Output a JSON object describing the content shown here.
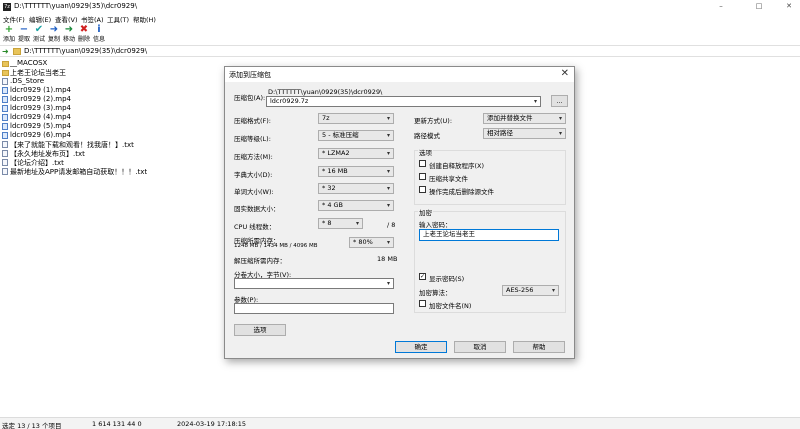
{
  "window": {
    "title": "D:\\TTTTTT\\yuan\\0929(35)\\dcr0929\\",
    "app_icon": "7z",
    "controls": [
      "–",
      "□",
      "✕"
    ]
  },
  "menu": [
    "文件(F)",
    "编辑(E)",
    "查看(V)",
    "书签(A)",
    "工具(T)",
    "帮助(H)"
  ],
  "toolbar": [
    {
      "label": "添加",
      "icon": "add-icon",
      "glyph": "+",
      "color": "#2a9d2a"
    },
    {
      "label": "提取",
      "icon": "extract-icon",
      "glyph": "−",
      "color": "#1f5fc4"
    },
    {
      "label": "测试",
      "icon": "test-icon",
      "glyph": "✔",
      "color": "#1aa3a3"
    },
    {
      "label": "复制",
      "icon": "copy-icon",
      "glyph": "➜",
      "color": "#1f5fc4"
    },
    {
      "label": "移动",
      "icon": "move-icon",
      "glyph": "➜",
      "color": "#1a8a3a"
    },
    {
      "label": "删除",
      "icon": "delete-icon",
      "glyph": "✖",
      "color": "#d02020"
    },
    {
      "label": "信息",
      "icon": "info-icon",
      "glyph": "i",
      "color": "#1f5fc4"
    }
  ],
  "address": {
    "path": "D:\\TTTTTT\\yuan\\0929(35)\\dcr0929\\"
  },
  "files": [
    {
      "name": "__MACOSX",
      "type": "folder"
    },
    {
      "name": "上老王论坛当老王",
      "type": "folder"
    },
    {
      "name": ".DS_Store",
      "type": "file"
    },
    {
      "name": "ldcr0929 (1).mp4",
      "type": "mp4"
    },
    {
      "name": "ldcr0929 (2).mp4",
      "type": "mp4"
    },
    {
      "name": "ldcr0929 (3).mp4",
      "type": "mp4"
    },
    {
      "name": "ldcr0929 (4).mp4",
      "type": "mp4"
    },
    {
      "name": "ldcr0929 (5).mp4",
      "type": "mp4"
    },
    {
      "name": "ldcr0929 (6).mp4",
      "type": "mp4"
    },
    {
      "name": "【来了就能下载和观看！找我唐！】.txt",
      "type": "file"
    },
    {
      "name": "【永久地址发布页】.txt",
      "type": "file"
    },
    {
      "name": "【论坛介绍】.txt",
      "type": "file"
    },
    {
      "name": "最新地址及APP请发邮箱自动获取！！！.txt",
      "type": "file"
    }
  ],
  "status": {
    "selection": "选定 13 / 13 个项目",
    "size": "1 614 131 44 0",
    "datetime": "2024-03-19 17:18:15"
  },
  "dialog": {
    "title": "添加到压缩包",
    "archive_label": "压缩包(A):",
    "archive_dir": "D:\\TTTTTT\\yuan\\0929(35)\\dcr0929\\",
    "archive_name": "ldcr0929.7z",
    "browse_label": "...",
    "format_label": "压缩格式(F):",
    "format_value": "7z",
    "level_label": "压缩等级(L):",
    "level_value": "5 - 标准压缩",
    "method_label": "压缩方法(M):",
    "method_value": "* LZMA2",
    "dict_label": "字典大小(D):",
    "dict_value": "* 16 MB",
    "word_label": "单词大小(W):",
    "word_value": "* 32",
    "solid_label": "固实数据大小：",
    "solid_value": "* 4 GB",
    "cpu_label": "CPU 线程数：",
    "cpu_value": "* 8",
    "cpu_total": "/ 8",
    "mem_label": "压缩所需内存：",
    "mem_detail": "1248 MB / 1434 MB / 4096 MB",
    "mem_value": "* 80%",
    "decomp_label": "解压缩所需内存：",
    "decomp_value": "18 MB",
    "split_label": "分卷大小，字节(V):",
    "split_value": "",
    "params_label": "参数(P):",
    "params_value": "",
    "options_button": "选项",
    "update_label": "更新方式(U):",
    "update_value": "添加并替换文件",
    "pathmode_label": "路径模式",
    "pathmode_value": "相对路径",
    "options_group": "选项",
    "opt_sfx": "创建自释放程序(X)",
    "opt_shared": "压缩共享文件",
    "opt_delete": "操作完成后删除源文件",
    "encrypt_group": "加密",
    "password_label": "输入密码：",
    "password_value": "上老王论坛当老王",
    "show_password": "显示密码(S)",
    "show_password_checked": true,
    "enc_method_label": "加密算法：",
    "enc_method_value": "AES-256",
    "encrypt_names": "加密文件名(N)",
    "ok_label": "确定",
    "cancel_label": "取消",
    "help_label": "帮助"
  }
}
